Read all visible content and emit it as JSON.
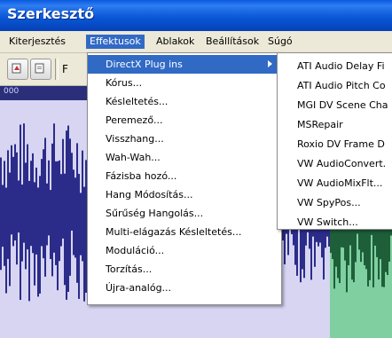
{
  "window": {
    "title": "Szerkesztő"
  },
  "menubar": {
    "items": [
      {
        "label": "Kiterjesztés"
      },
      {
        "label": "Effektusok"
      },
      {
        "label": "Ablakok"
      },
      {
        "label": "Beállítások"
      },
      {
        "label": "Súgó"
      }
    ]
  },
  "toolbar": {
    "partial_label": "F"
  },
  "ruler": {
    "start_label": "000"
  },
  "effects_menu": {
    "items": [
      {
        "label": "DirectX Plug ins"
      },
      {
        "label": "Kórus..."
      },
      {
        "label": "Késleltetés..."
      },
      {
        "label": "Peremező..."
      },
      {
        "label": "Visszhang..."
      },
      {
        "label": "Wah-Wah..."
      },
      {
        "label": "Fázisba hozó..."
      },
      {
        "label": "Hang Módosítás..."
      },
      {
        "label": "Sűrűség Hangolás..."
      },
      {
        "label": "Multi-elágazás Késleltetés..."
      },
      {
        "label": "Moduláció..."
      },
      {
        "label": "Torzítás..."
      },
      {
        "label": "Újra-analóg..."
      }
    ]
  },
  "directx_submenu": {
    "items": [
      {
        "label": "ATI Audio Delay Fi"
      },
      {
        "label": "ATI Audio Pitch Co"
      },
      {
        "label": "MGI DV Scene Cha"
      },
      {
        "label": "MSRepair"
      },
      {
        "label": "Roxio DV Frame D"
      },
      {
        "label": "VW AudioConvert."
      },
      {
        "label": "VW AudioMixFlt..."
      },
      {
        "label": "VW SpyPos..."
      },
      {
        "label": "VW Switch..."
      }
    ]
  },
  "colors": {
    "highlight": "#316ac5",
    "waveform": "#2b2c8a",
    "selection": "#7fcfa0"
  }
}
